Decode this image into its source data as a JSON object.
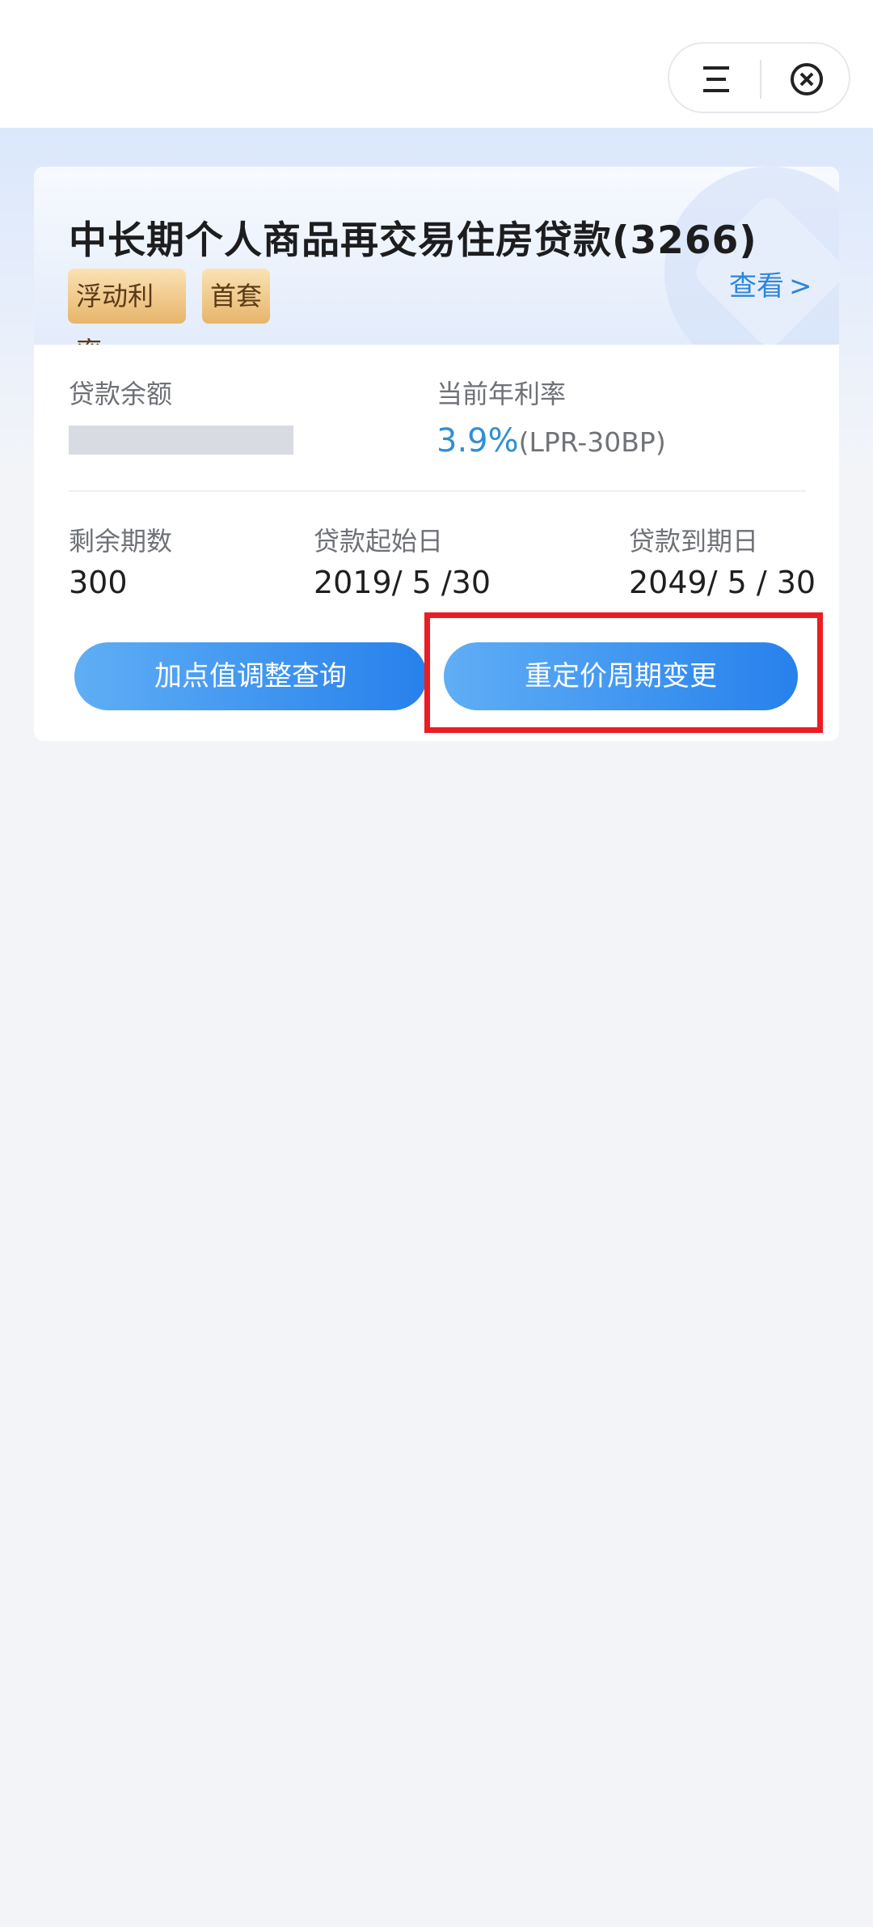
{
  "nav": {
    "menu_icon": "menu-icon",
    "close_icon": "close-circle-icon"
  },
  "loan": {
    "title": "中长期个人商品再交易住房贷款(3266)",
    "tags": [
      "浮动利率",
      "首套"
    ],
    "view_label": "查看",
    "view_chevron": ">",
    "balance_label": "贷款余额",
    "rate_label": "当前年利率",
    "rate_value": "3.9%",
    "rate_note": "(LPR-30BP)",
    "remaining_label": "剩余期数",
    "remaining_value": "300",
    "start_label": "贷款起始日",
    "start_value": "2019/ 5 /30",
    "end_label": "贷款到期日",
    "end_value": "2049/ 5 / 30"
  },
  "actions": {
    "adjust_query": "加点值调整查询",
    "repricing_change": "重定价周期变更"
  },
  "colors": {
    "accent_blue": "#2f8fd4",
    "button_gradient_start": "#5faef5",
    "button_gradient_end": "#2781ec",
    "highlight_red": "#ec1c24",
    "tag_gold": "#e6b56b"
  }
}
